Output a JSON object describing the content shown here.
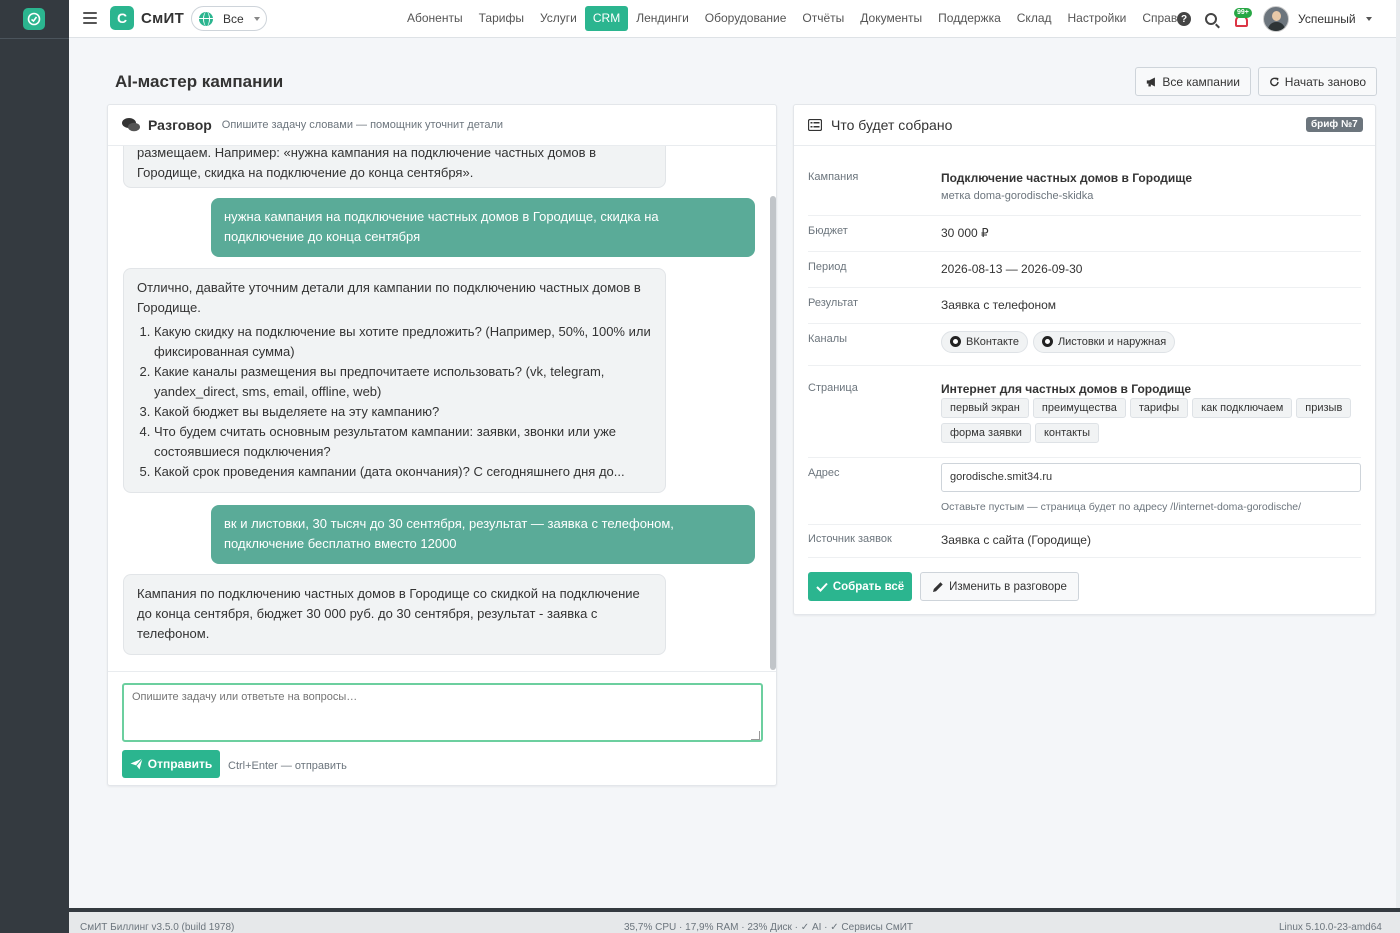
{
  "nav": {
    "brand_badge": "С",
    "brand_name": "СмИТ",
    "scope": "Все",
    "links": [
      "Абоненты",
      "Тарифы",
      "Услуги",
      "CRM",
      "Лендинги",
      "Оборудование",
      "Отчёты",
      "Документы",
      "Поддержка",
      "Склад",
      "Настройки",
      "Справ."
    ],
    "active_link": "CRM",
    "notification_count": "99+",
    "user_name": "Успешный"
  },
  "page": {
    "title": "AI-мастер кампании",
    "btn_all_campaigns": "Все кампании",
    "btn_restart": "Начать заново"
  },
  "chat": {
    "title": "Разговор",
    "subtitle": "Опишите задачу словами — помощник уточнит детали",
    "messages": {
      "m0": "размещаем. Например: «нужна кампания на подключение частных домов в Городище, скидка на подключение до конца сентября».",
      "m1": "нужна кампания на подключение частных домов в Городище, скидка на подключение до конца сентября",
      "m2_intro": "Отлично, давайте уточним детали для кампании по подключению частных домов в Городище.",
      "m2_items": [
        "Какую скидку на подключение вы хотите предложить? (Например, 50%, 100% или фиксированная сумма)",
        "Какие каналы размещения вы предпочитаете использовать? (vk, telegram, yandex_direct, sms, email, offline, web)",
        "Какой бюджет вы выделяете на эту кампанию?",
        "Что будем считать основным результатом кампании: заявки, звонки или уже состоявшиеся подключения?",
        "Какой срок проведения кампании (дата окончания)? С сегодняшнего дня до..."
      ],
      "m3": "вк и листовки, 30 тысяч до 30 сентября, результат — заявка с телефоном, подключение бесплатно вместо 12000",
      "m4": "Кампания по подключению частных домов в Городище со скидкой на подключение до конца сентября, бюджет 30 000 руб. до 30 сентября, результат - заявка с телефоном."
    },
    "input_placeholder": "Опишите задачу или ответьте на вопросы…",
    "send_label": "Отправить",
    "send_hint": "Ctrl+Enter — отправить"
  },
  "brief": {
    "title": "Что будет собрано",
    "badge": "бриф №7",
    "labels": {
      "campaign": "Кампания",
      "budget": "Бюджет",
      "period": "Период",
      "result": "Результат",
      "channels": "Каналы",
      "page": "Страница",
      "address": "Адрес",
      "source": "Источник заявок"
    },
    "campaign_name": "Подключение частных домов в Городище",
    "campaign_tag": "метка doma-gorodische-skidka",
    "budget": "30 000 ₽",
    "period": "2026-08-13 — 2026-09-30",
    "result": "Заявка с телефоном",
    "channels": [
      "ВКонтакте",
      "Листовки и наружная"
    ],
    "page_title": "Интернет для частных домов в Городище",
    "page_sections": [
      "первый экран",
      "преимущества",
      "тарифы",
      "как подключаем",
      "призыв",
      "форма заявки",
      "контакты"
    ],
    "address_value": "gorodische.smit34.ru",
    "address_hint": "Оставьте пустым — страница будет по адресу /l/internet-doma-gorodische/",
    "source": "Заявка с сайта (Городище)",
    "collect_label": "Собрать всё",
    "edit_label": "Изменить в разговоре"
  },
  "footer": {
    "left": "СмИТ Биллинг v3.5.0 (build 1978)",
    "center": "35,7% CPU · 17,9% RAM · 23% Диск · ✓ AI · ✓ Сервисы СмИТ",
    "right": "Linux 5.10.0-23-amd64"
  },
  "colors": {
    "accent": "#2bb58f",
    "user_bubble": "#5aab98",
    "sidebar": "#343a40"
  }
}
